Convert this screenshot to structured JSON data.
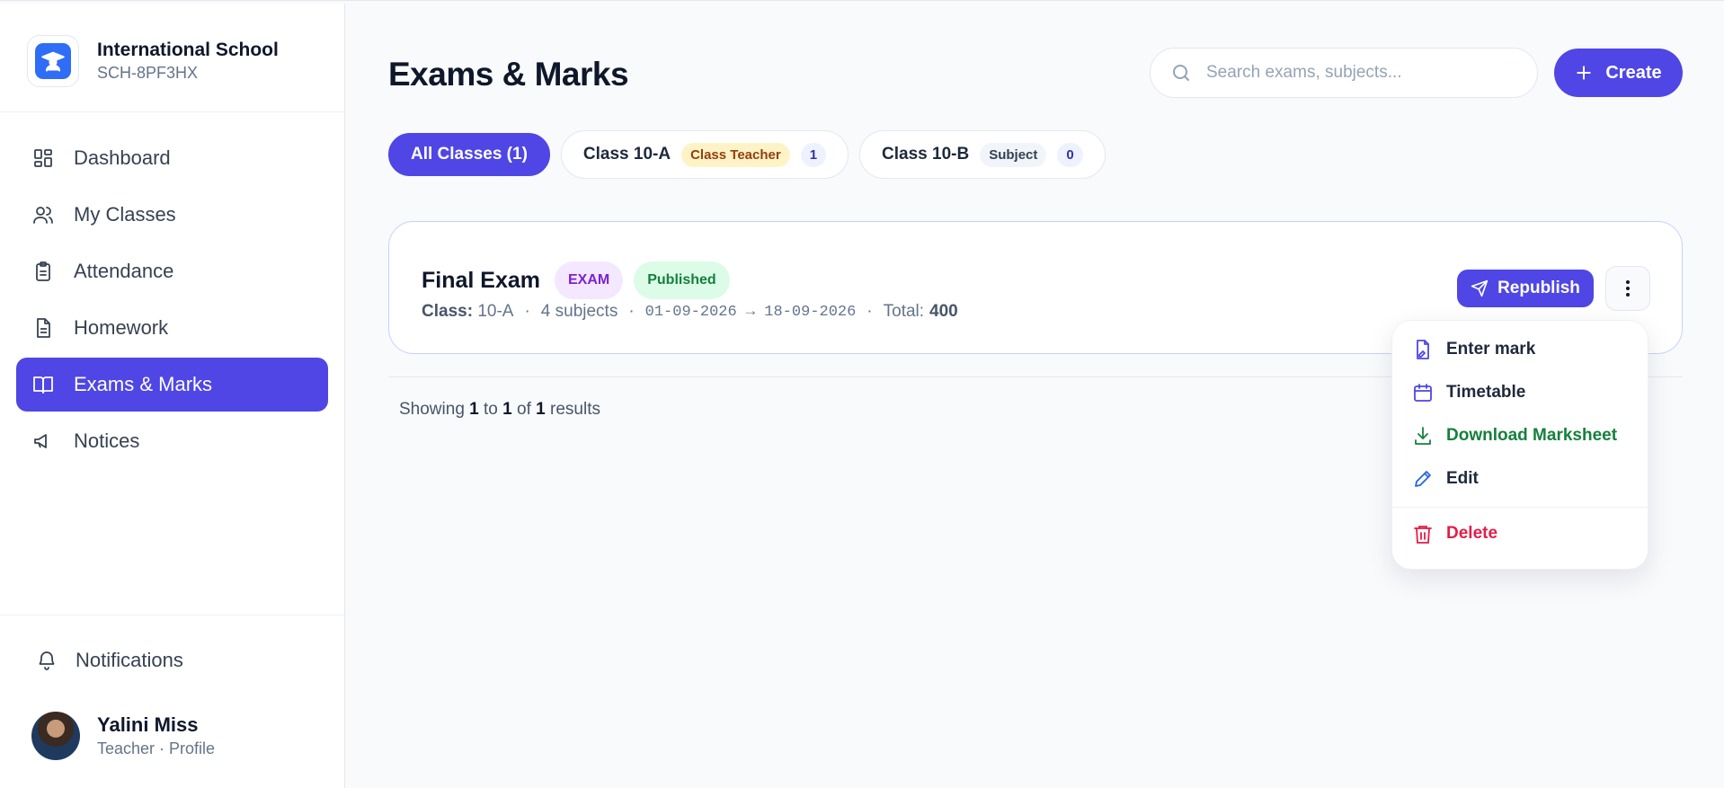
{
  "school": {
    "name": "International School",
    "code": "SCH-8PF3HX"
  },
  "nav": [
    {
      "label": "Dashboard",
      "icon": "dashboard-icon"
    },
    {
      "label": "My Classes",
      "icon": "users-icon"
    },
    {
      "label": "Attendance",
      "icon": "clipboard-icon"
    },
    {
      "label": "Homework",
      "icon": "document-icon"
    },
    {
      "label": "Exams & Marks",
      "icon": "book-icon",
      "active": true
    },
    {
      "label": "Notices",
      "icon": "megaphone-icon"
    }
  ],
  "notifications_label": "Notifications",
  "user": {
    "name": "Yalini Miss",
    "role": "Teacher · Profile"
  },
  "page": {
    "title": "Exams & Marks"
  },
  "search": {
    "placeholder": "Search exams, subjects..."
  },
  "create_label": "Create",
  "filters": {
    "all": "All Classes (1)",
    "classes": [
      {
        "name": "Class 10-A",
        "tag": "Class Teacher",
        "count": "1"
      },
      {
        "name": "Class 10-B",
        "tag": "Subject",
        "count": "0"
      }
    ]
  },
  "exam": {
    "name": "Final Exam",
    "type_badge": "EXAM",
    "status_badge": "Published",
    "class_label": "Class:",
    "class_value": "10-A",
    "subjects": "4 subjects",
    "dates": "01-09-2026 → 18-09-2026",
    "total_label": "Total:",
    "total_value": "400",
    "republish_label": "Republish"
  },
  "pagination": {
    "prefix": "Showing",
    "from": "1",
    "to_word": "to",
    "to": "1",
    "of_word": "of",
    "total": "1",
    "suffix": "results"
  },
  "menu": {
    "enter_mark": "Enter mark",
    "timetable": "Timetable",
    "download": "Download Marksheet",
    "edit": "Edit",
    "delete": "Delete"
  },
  "colors": {
    "accent": "#4f46e5",
    "success": "#15803d",
    "danger": "#e11d48"
  }
}
